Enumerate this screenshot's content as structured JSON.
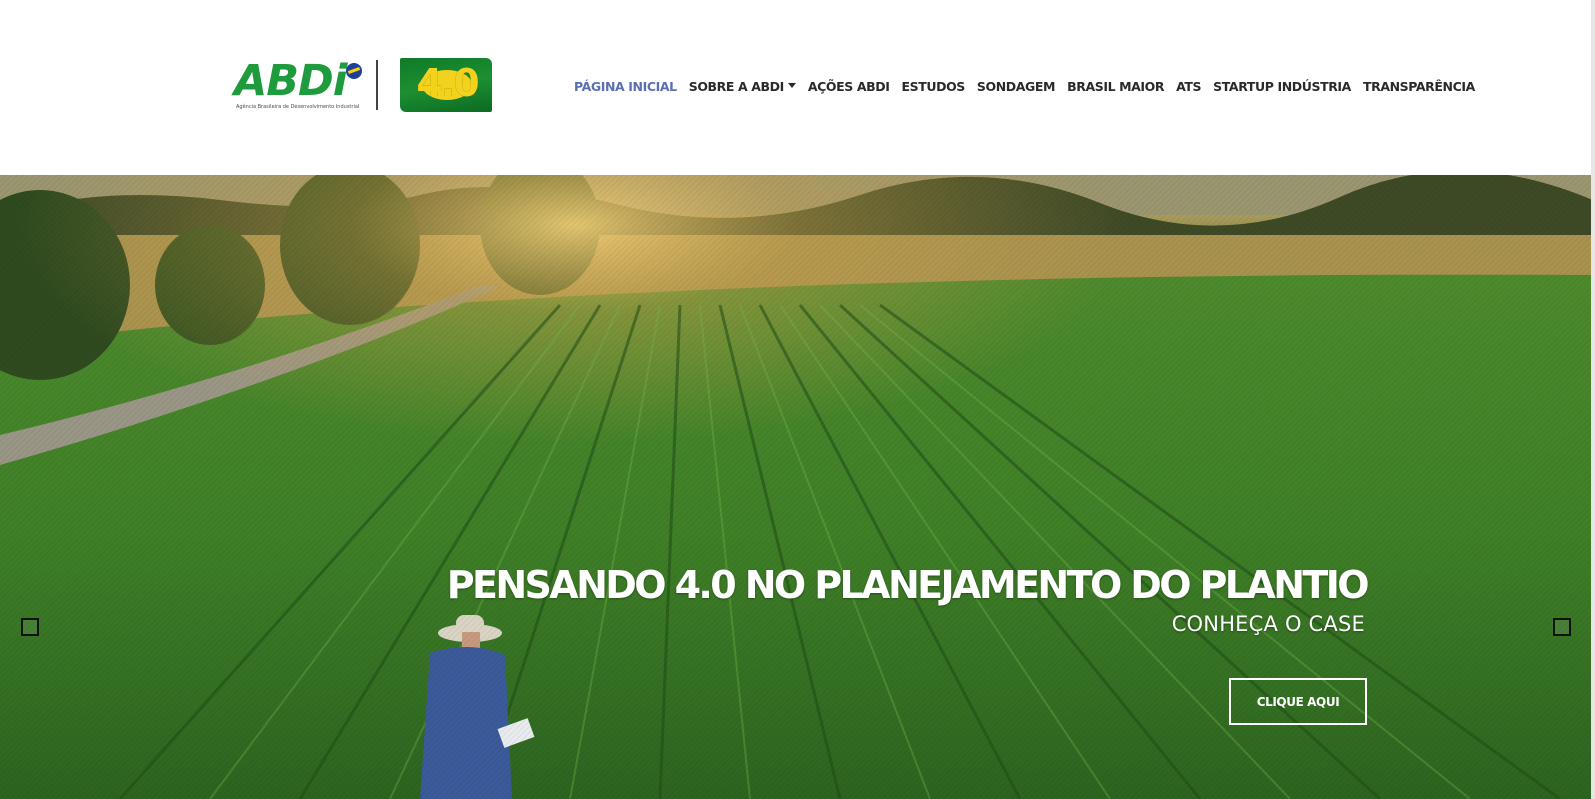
{
  "header": {
    "logo": {
      "brand": "ABDi",
      "tagline": "Agência Brasileira de Desenvolvimento Industrial",
      "badge": "4.0"
    },
    "nav": [
      {
        "label": "PÁGINA INICIAL",
        "active": true
      },
      {
        "label": "SOBRE A ABDI",
        "dropdown": true
      },
      {
        "label": "AÇÕES ABDI"
      },
      {
        "label": "ESTUDOS"
      },
      {
        "label": "SONDAGEM"
      },
      {
        "label": "BRASIL MAIOR"
      },
      {
        "label": "ATS"
      },
      {
        "label": "STARTUP INDÚSTRIA"
      },
      {
        "label": "TRANSPARÊNCIA"
      }
    ]
  },
  "hero": {
    "title": "PENSANDO 4.0 NO PLANEJAMENTO DO PLANTIO",
    "subtitle": "CONHEÇA O CASE",
    "cta_label": "CLIQUE AQUI",
    "prev_icon": "chevron-left-icon",
    "next_icon": "chevron-right-icon"
  },
  "colors": {
    "nav_active": "#5b6fb0",
    "nav_text": "#2a2a2a",
    "brand_green": "#1e9b3c",
    "brand_blue": "#1f3f99"
  }
}
